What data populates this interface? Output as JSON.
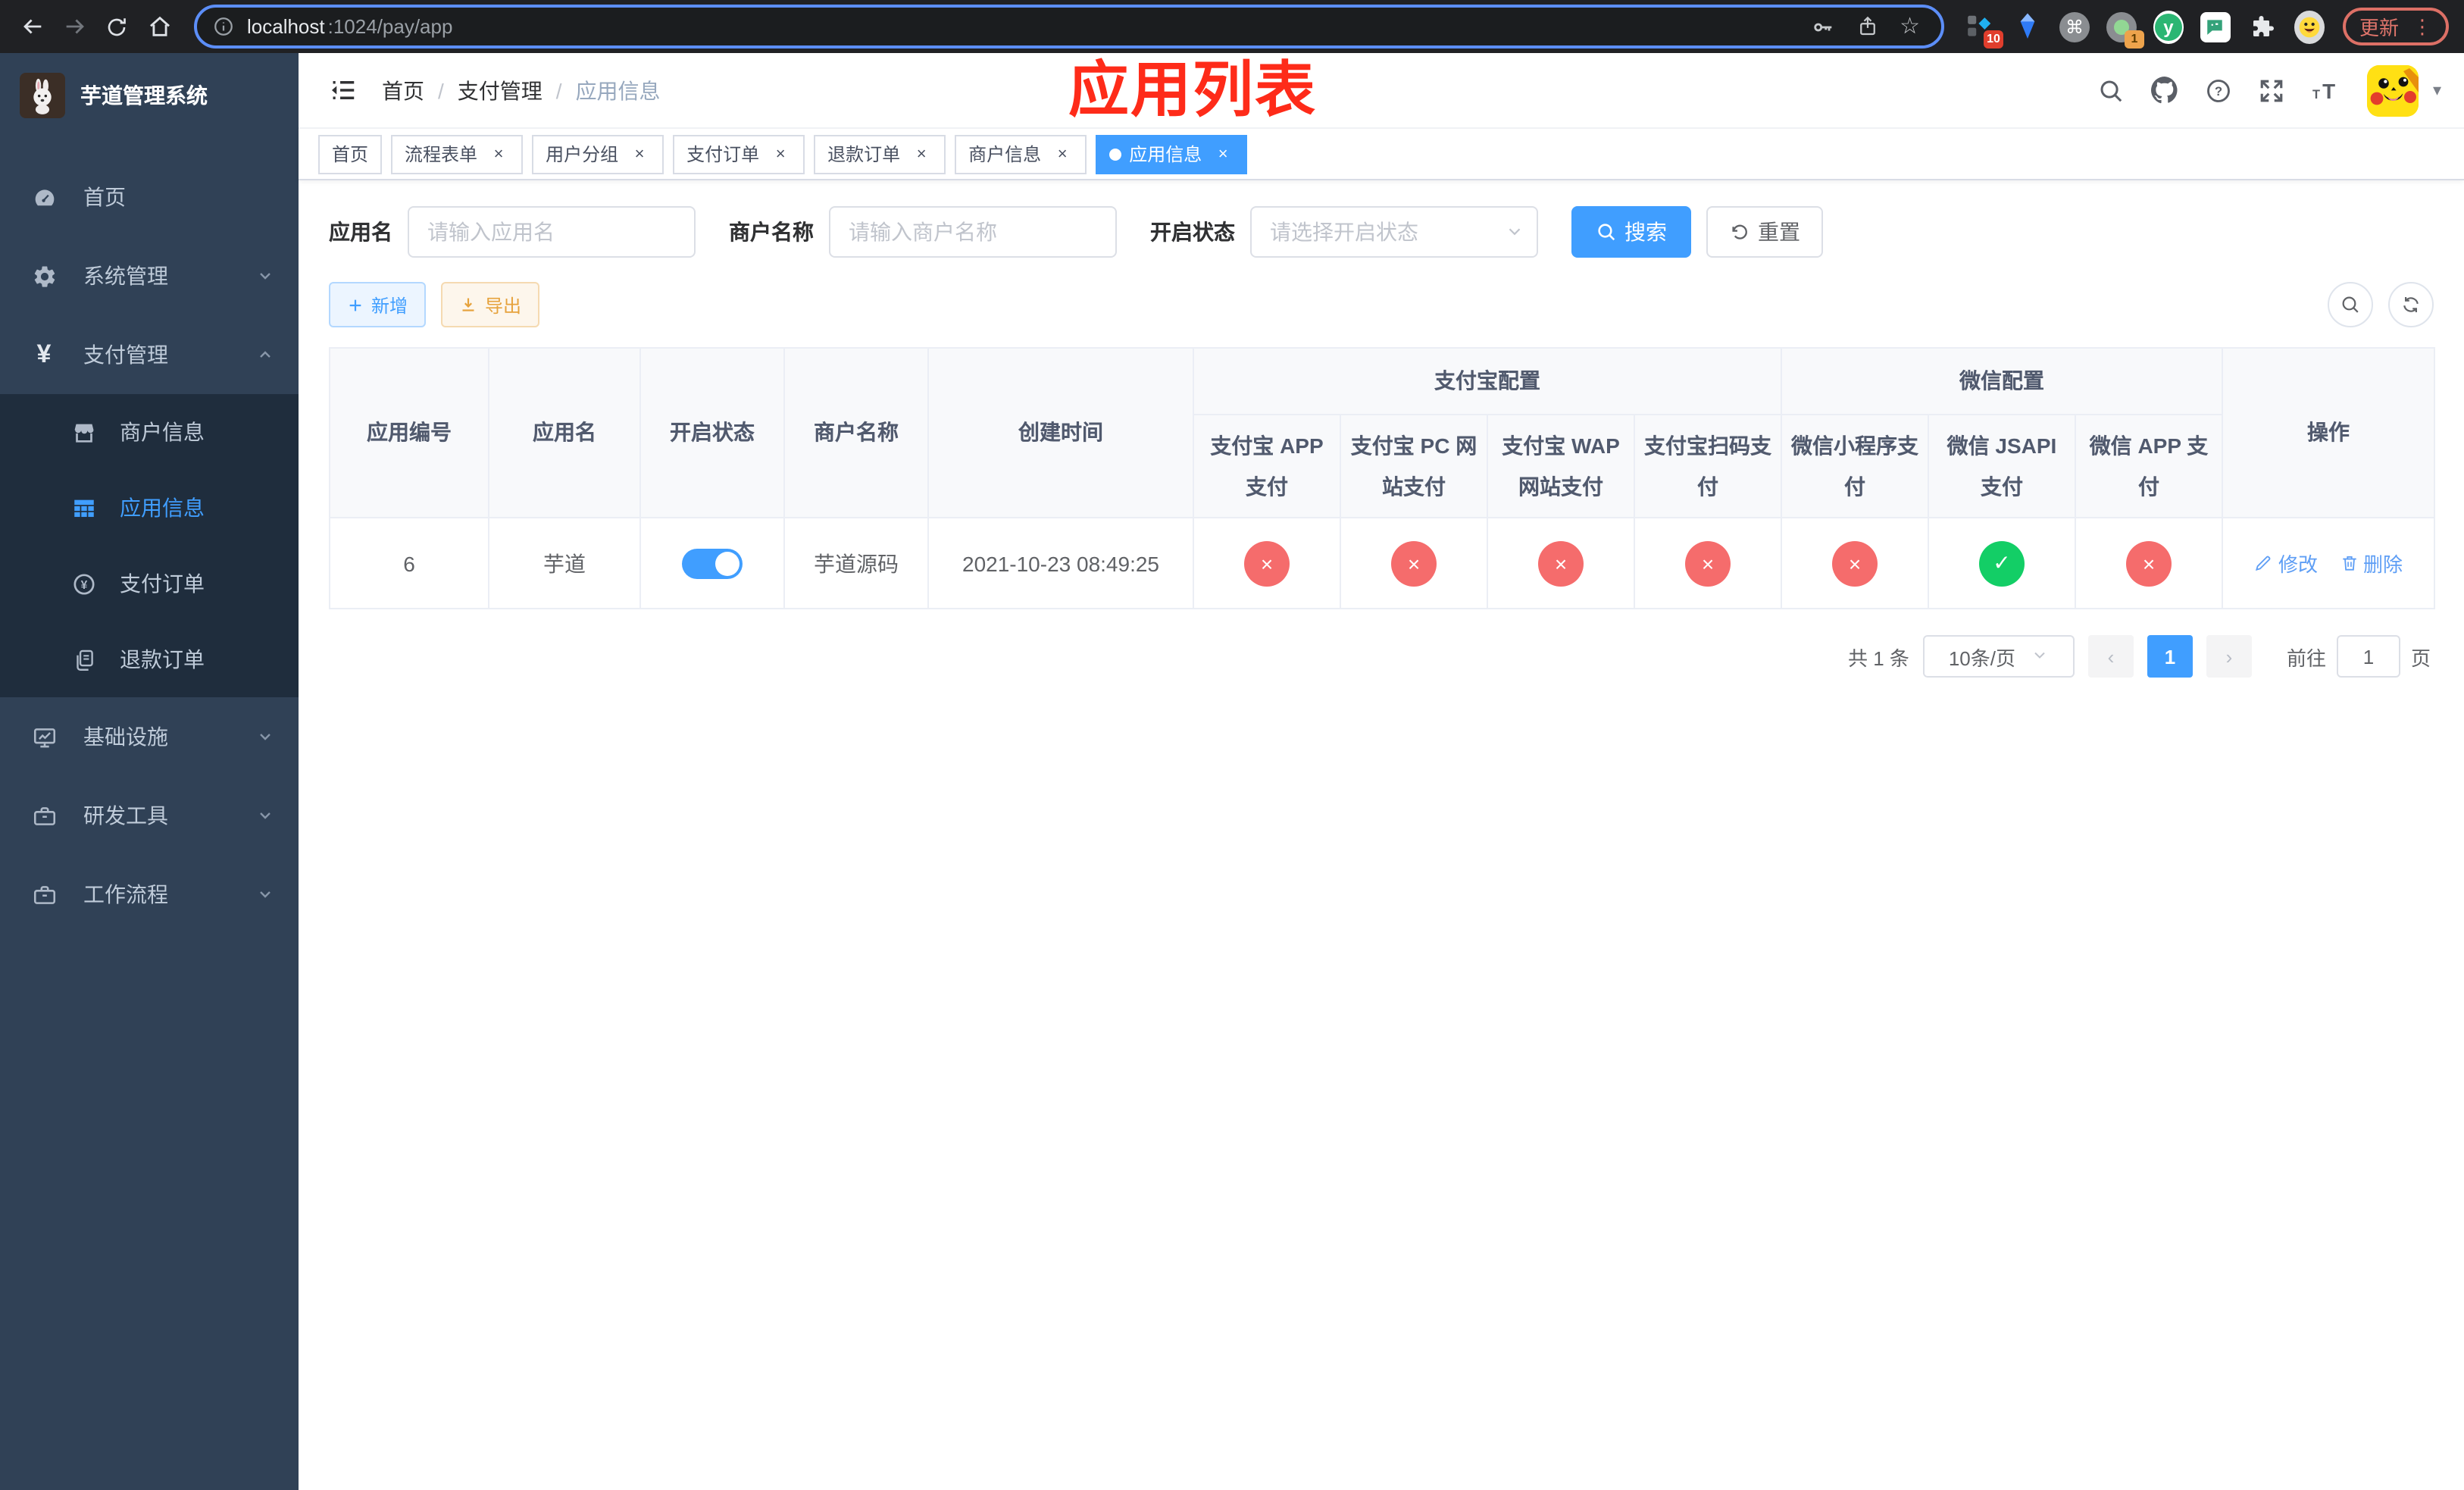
{
  "glyphs": {
    "yen": "¥",
    "close": "×",
    "check": "✓",
    "cross": "×",
    "prev": "‹",
    "next": "›",
    "cmd": "⌘",
    "dots": "⋮",
    "star": "☆",
    "caret": "▾",
    "question": "?",
    "plus": "+",
    "yuque": "y"
  },
  "colors": {
    "primary": "#409eff",
    "danger": "#f56c6c",
    "success": "#13ce66",
    "warning": "#e6a23c",
    "annotation": "#fe2b19",
    "sidebar": "#304156",
    "submenu": "#1f2d3d"
  },
  "browser": {
    "url_host": "localhost",
    "url_path": ":1024/pay/app",
    "update_label": "更新",
    "ext_badge_a": "10",
    "ext_badge_b": "1"
  },
  "sidebar": {
    "logo_title": "芋道管理系统",
    "menu": [
      {
        "label": "首页"
      },
      {
        "label": "系统管理"
      },
      {
        "label": "支付管理"
      },
      {
        "label": "基础设施"
      },
      {
        "label": "研发工具"
      },
      {
        "label": "工作流程"
      }
    ],
    "submenu": [
      {
        "label": "商户信息"
      },
      {
        "label": "应用信息"
      },
      {
        "label": "支付订单"
      },
      {
        "label": "退款订单"
      }
    ]
  },
  "navbar": {
    "breadcrumb": [
      "首页",
      "支付管理",
      "应用信息"
    ],
    "annotation": "应用列表"
  },
  "tags": [
    {
      "label": "首页"
    },
    {
      "label": "流程表单"
    },
    {
      "label": "用户分组"
    },
    {
      "label": "支付订单"
    },
    {
      "label": "退款订单"
    },
    {
      "label": "商户信息"
    },
    {
      "label": "应用信息"
    }
  ],
  "filters": {
    "app_name": {
      "label": "应用名",
      "placeholder": "请输入应用名",
      "value": ""
    },
    "merchant_name": {
      "label": "商户名称",
      "placeholder": "请输入商户名称",
      "value": ""
    },
    "status": {
      "label": "开启状态",
      "placeholder": "请选择开启状态",
      "value": ""
    },
    "search_label": "搜索",
    "reset_label": "重置"
  },
  "toolbar": {
    "add_label": "新增",
    "export_label": "导出"
  },
  "table": {
    "col_app_id": "应用编号",
    "col_app_name": "应用名",
    "col_status": "开启状态",
    "col_merchant": "商户名称",
    "col_created": "创建时间",
    "group_alipay": "支付宝配置",
    "group_wechat": "微信配置",
    "col_actions": "操作",
    "sub_cols": [
      "支付宝 APP 支付",
      "支付宝 PC 网站支付",
      "支付宝 WAP 网站支付",
      "支付宝扫码支付",
      "微信小程序支付",
      "微信 JSAPI 支付",
      "微信 APP 支付"
    ],
    "row": {
      "app_id": "6",
      "app_name": "芋道",
      "status_on": true,
      "merchant": "芋道源码",
      "created": "2021-10-23 08:49:25",
      "pay_status": [
        "disabled",
        "disabled",
        "disabled",
        "disabled",
        "disabled",
        "enabled",
        "disabled"
      ],
      "marks": [
        "×",
        "×",
        "×",
        "×",
        "×",
        "✓",
        "×"
      ],
      "edit_label": "修改",
      "delete_label": "删除"
    }
  },
  "pagination": {
    "total": "共 1 条",
    "page_size": "10条/页",
    "page": "1",
    "goto_label": "前往",
    "goto_value": "1",
    "unit": "页"
  }
}
